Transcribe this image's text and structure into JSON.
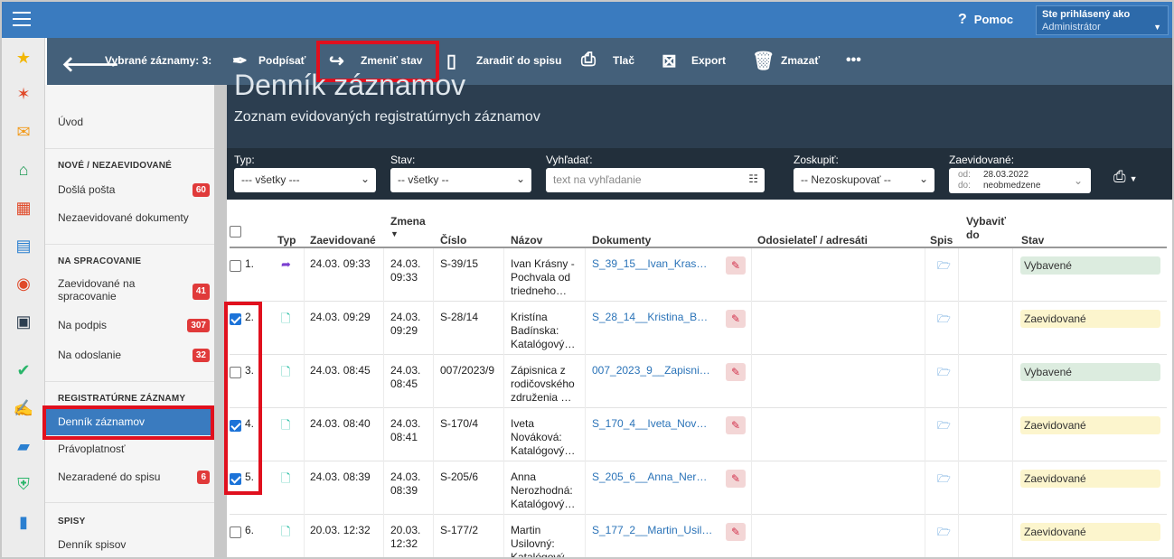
{
  "topbar": {
    "help_label": "Pomoc",
    "help_icon": "?",
    "user_line1": "Ste prihlásený ako",
    "user_line2": "Administrátor"
  },
  "iconbar": {
    "icons": [
      "star-icon",
      "magic-wand-icon",
      "mail-icon",
      "home-icon",
      "calendar-grid-icon",
      "book-icon",
      "person-icon",
      "schedule-icon",
      "check-circle-icon",
      "signature-icon",
      "briefcase-icon",
      "shield-icon",
      "chart-icon"
    ]
  },
  "sidebar": {
    "intro": "Úvod",
    "sections": {
      "new": "NOVÉ / NEZAEVIDOVANÉ",
      "processing": "NA SPRACOVANIE",
      "registry": "REGISTRATÚRNE ZÁZNAMY",
      "files": "SPISY"
    },
    "items": {
      "dosla_posta": {
        "label": "Došlá pošta",
        "count": "60"
      },
      "nezaevidovane": {
        "label": "Nezaevidované dokumenty"
      },
      "zaev_spracovanie": {
        "label": "Zaevidované na spracovanie",
        "count": "41"
      },
      "na_podpis": {
        "label": "Na podpis",
        "count": "307"
      },
      "na_odoslanie": {
        "label": "Na odoslanie",
        "count": "32"
      },
      "dennik_zaznamov": {
        "label": "Denník záznamov"
      },
      "pravoplatnost": {
        "label": "Právoplatnosť"
      },
      "nezaradene": {
        "label": "Nezaradené do spisu",
        "count": "6"
      },
      "dennik_spisov": {
        "label": "Denník spisov"
      }
    }
  },
  "actionbar": {
    "selected_label": "Vybrané záznamy: 3:",
    "sign": "Podpísať",
    "change_state": "Zmeniť stav",
    "assign": "Zaradiť do spisu",
    "print": "Tlač",
    "export": "Export",
    "delete": "Zmazať",
    "more": "•••"
  },
  "header": {
    "title": "Denník záznamov",
    "subtitle": "Zoznam evidovaných registratúrnych záznamov"
  },
  "filters": {
    "type_label": "Typ:",
    "type_value": "--- všetky ---",
    "state_label": "Stav:",
    "state_value": "-- všetky --",
    "search_label": "Vyhľadať:",
    "search_placeholder": "text na vyhľadanie",
    "group_label": "Zoskupiť:",
    "group_value": "-- Nezoskupovať --",
    "registered_label": "Zaevidované:",
    "from_label": "od:",
    "from_value": "28.03.2022",
    "to_label": "do:",
    "to_value": "neobmedzene"
  },
  "table": {
    "headers": {
      "type": "Typ",
      "registered": "Zaevidované",
      "changed": "Zmena",
      "number": "Číslo",
      "name": "Názov",
      "documents": "Dokumenty",
      "sender": "Odosielateľ / adresáti",
      "file": "Spis",
      "resolve1": "Vybaviť",
      "resolve2": "do",
      "state": "Stav"
    },
    "rows": [
      {
        "idx": "1.",
        "checked": false,
        "registered": "24.03. 09:33",
        "changed1": "24.03.",
        "changed2": "09:33",
        "number": "S-39/15",
        "name1": "Ivan Krásny -",
        "name2": "Pochvala od",
        "name3": "triedneho…",
        "doc": "S_39_15__Ivan_Kras…",
        "state": "Vybavené",
        "state_kind": "vyb",
        "type_icon": "arrow-in-icon"
      },
      {
        "idx": "2.",
        "checked": true,
        "registered": "24.03. 09:29",
        "changed1": "24.03.",
        "changed2": "09:29",
        "number": "S-28/14",
        "name1": "Kristína",
        "name2": "Badínska:",
        "name3": "Katalógový…",
        "doc": "S_28_14__Kristina_B…",
        "state": "Zaevidované",
        "state_kind": "zaev",
        "type_icon": "document-icon"
      },
      {
        "idx": "3.",
        "checked": false,
        "registered": "24.03. 08:45",
        "changed1": "24.03.",
        "changed2": "08:45",
        "number": "007/2023/9",
        "name1": "Zápisnica z",
        "name2": "rodičovského",
        "name3": "združenia …",
        "doc": "007_2023_9__Zapisni…",
        "state": "Vybavené",
        "state_kind": "vyb",
        "type_icon": "document-icon"
      },
      {
        "idx": "4.",
        "checked": true,
        "registered": "24.03. 08:40",
        "changed1": "24.03.",
        "changed2": "08:41",
        "number": "S-170/4",
        "name1": "Iveta",
        "name2": "Nováková:",
        "name3": "Katalógový…",
        "doc": "S_170_4__Iveta_Nov…",
        "state": "Zaevidované",
        "state_kind": "zaev",
        "type_icon": "document-icon"
      },
      {
        "idx": "5.",
        "checked": true,
        "registered": "24.03. 08:39",
        "changed1": "24.03.",
        "changed2": "08:39",
        "number": "S-205/6",
        "name1": "Anna",
        "name2": "Nerozhodná:",
        "name3": "Katalógový…",
        "doc": "S_205_6__Anna_Ner…",
        "state": "Zaevidované",
        "state_kind": "zaev",
        "type_icon": "document-icon"
      },
      {
        "idx": "6.",
        "checked": false,
        "registered": "20.03. 12:32",
        "changed1": "20.03.",
        "changed2": "12:32",
        "number": "S-177/2",
        "name1": "Martin",
        "name2": "Usilovný:",
        "name3": "Katalógový",
        "doc": "S_177_2__Martin_Usil…",
        "state": "Zaevidované",
        "state_kind": "zaev",
        "type_icon": "document-icon"
      }
    ]
  },
  "colors": {
    "topbar": "#3a7bbf",
    "actionbar": "#44607a",
    "highlight": "#e0101e",
    "badge": "#e03a3a"
  }
}
